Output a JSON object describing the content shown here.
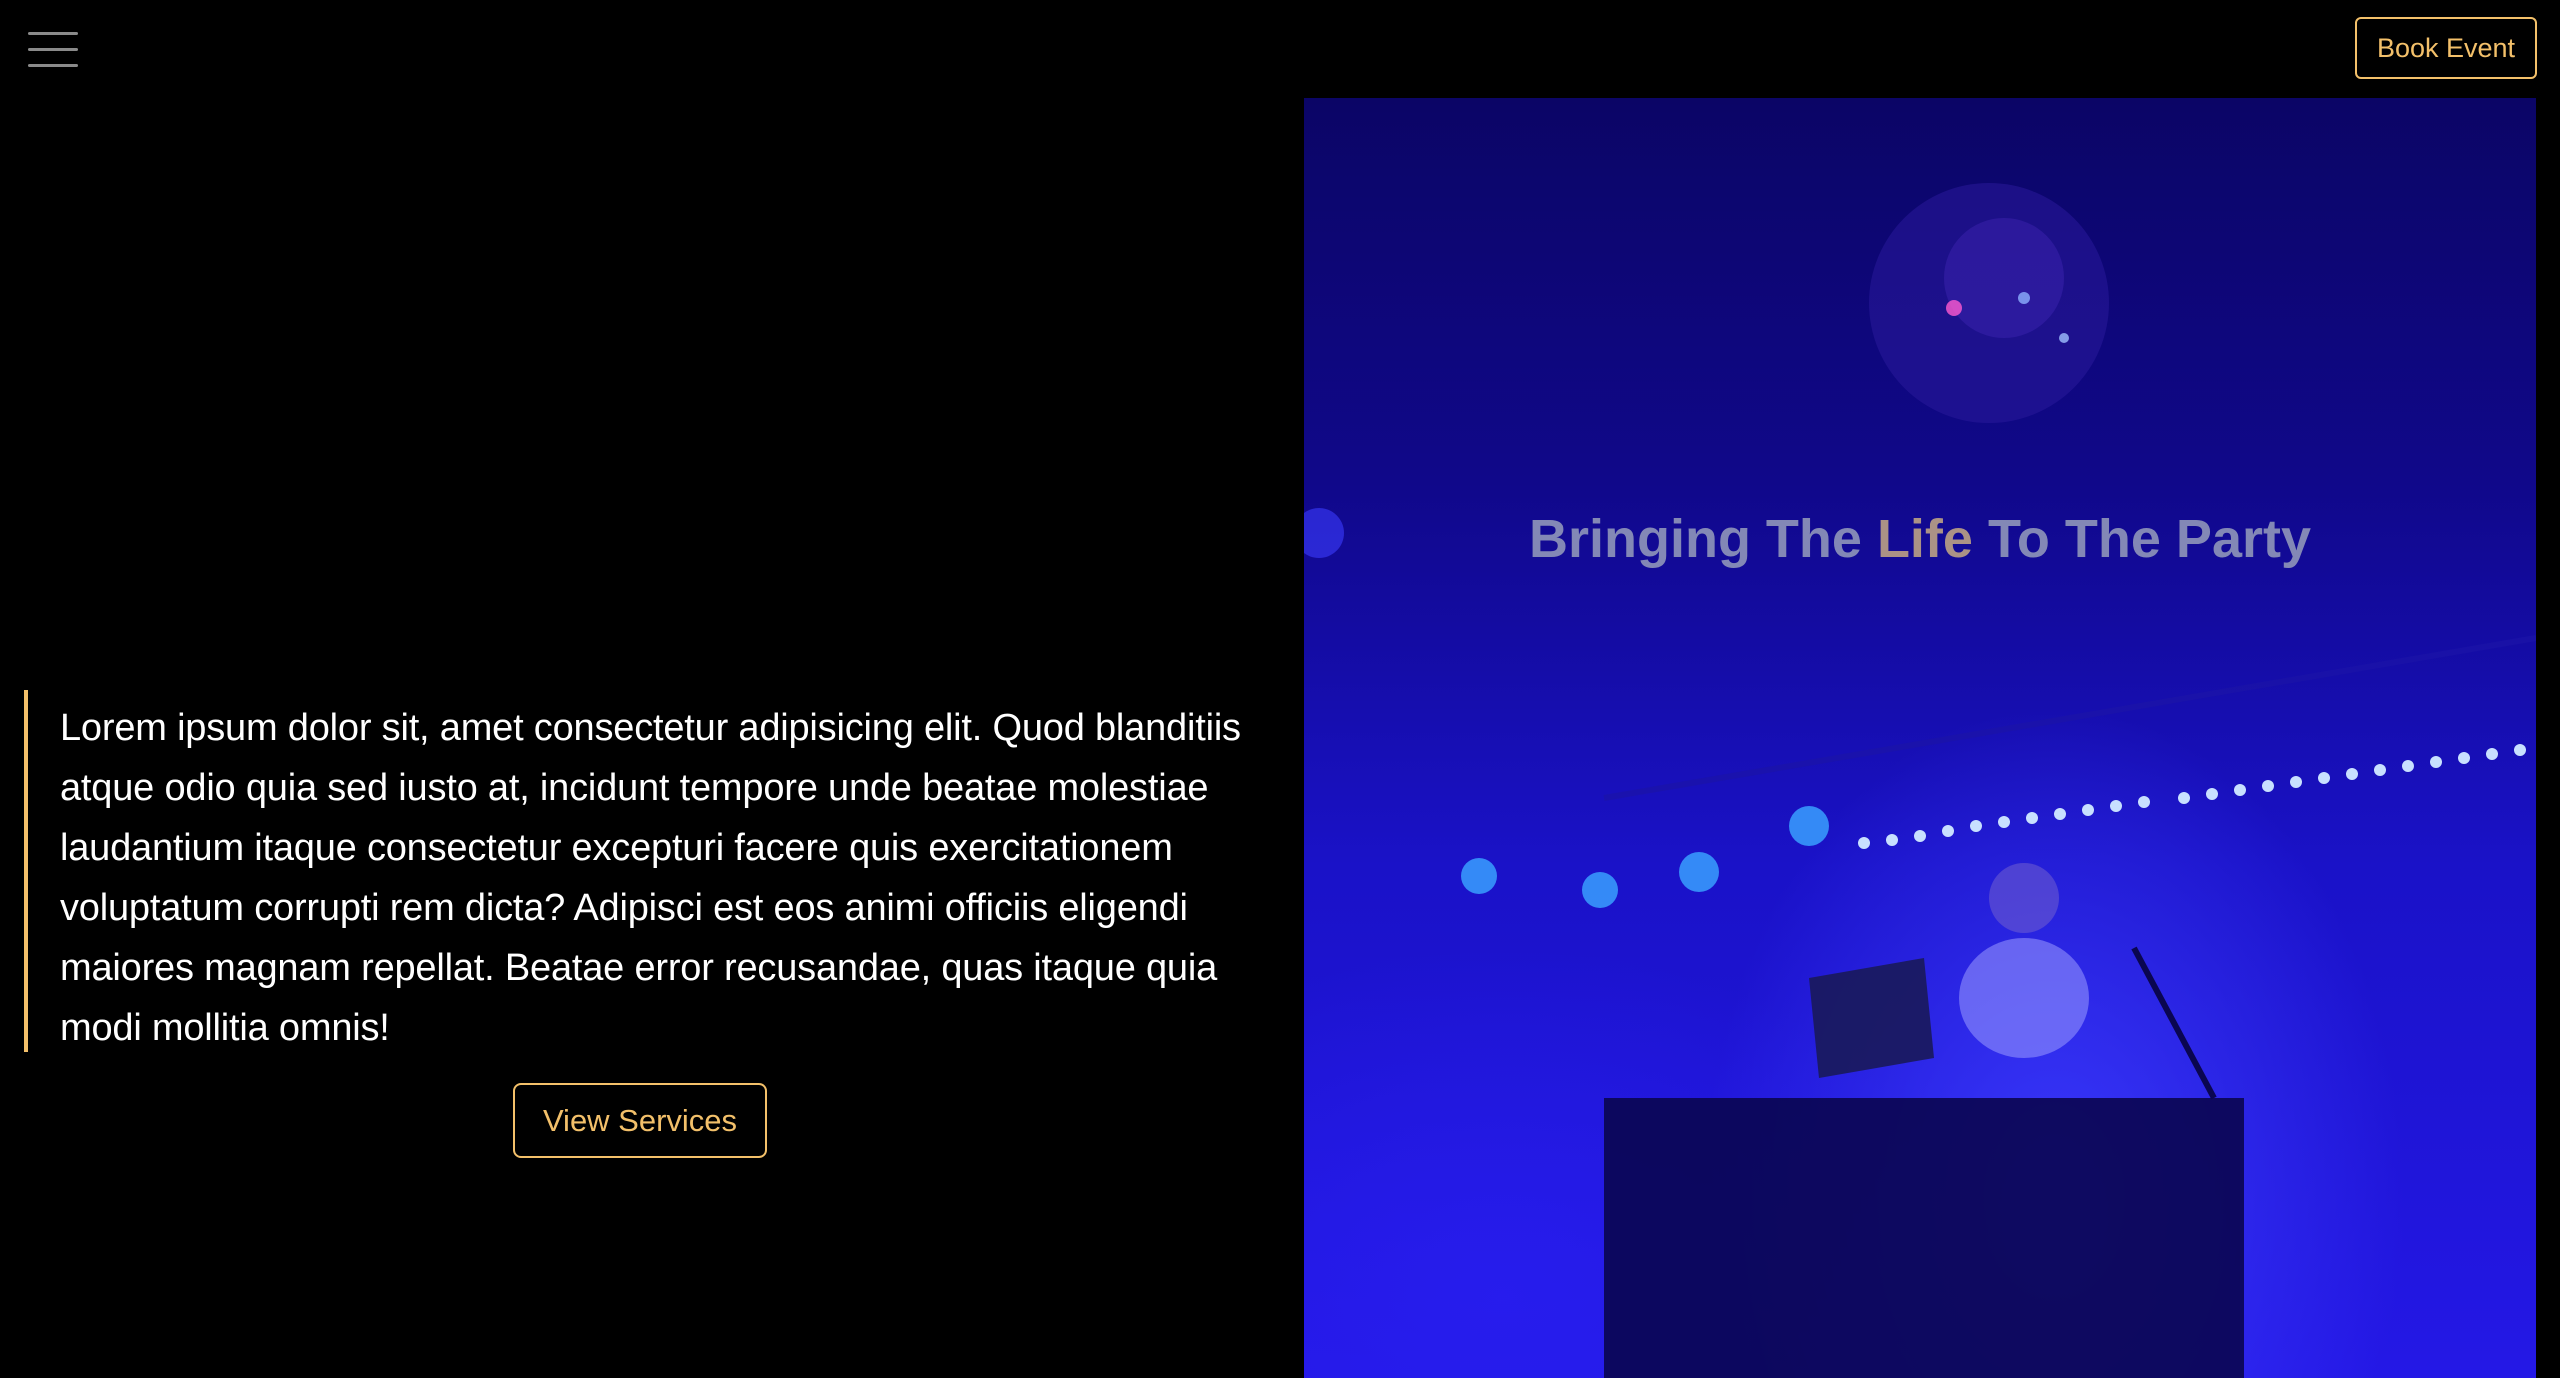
{
  "header": {
    "menu_icon": "hamburger-menu-icon",
    "book_label": "Book Event"
  },
  "intro": {
    "text": "Lorem ipsum dolor sit, amet consectetur adipisicing elit. Quod blanditiis atque odio quia sed iusto at, incidunt tempore unde beatae molestiae laudantium itaque consectetur excepturi facere quis exercitationem voluptatum corrupti rem dicta? Adipisci est eos animi officiis eligendi maiores magnam repellat. Beatae error recusandae, quas itaque quia modi mollitia omnis!",
    "button_label": "View Services"
  },
  "hero": {
    "title_before": "Bringing The ",
    "title_accent": "Life",
    "title_after": " To The Party",
    "image": "dj-performing-under-blue-lights"
  },
  "colors": {
    "background": "#000000",
    "accent": "#f3c06a",
    "hero_blue": "#2418e6",
    "title_gray": "#8a8fb8"
  }
}
